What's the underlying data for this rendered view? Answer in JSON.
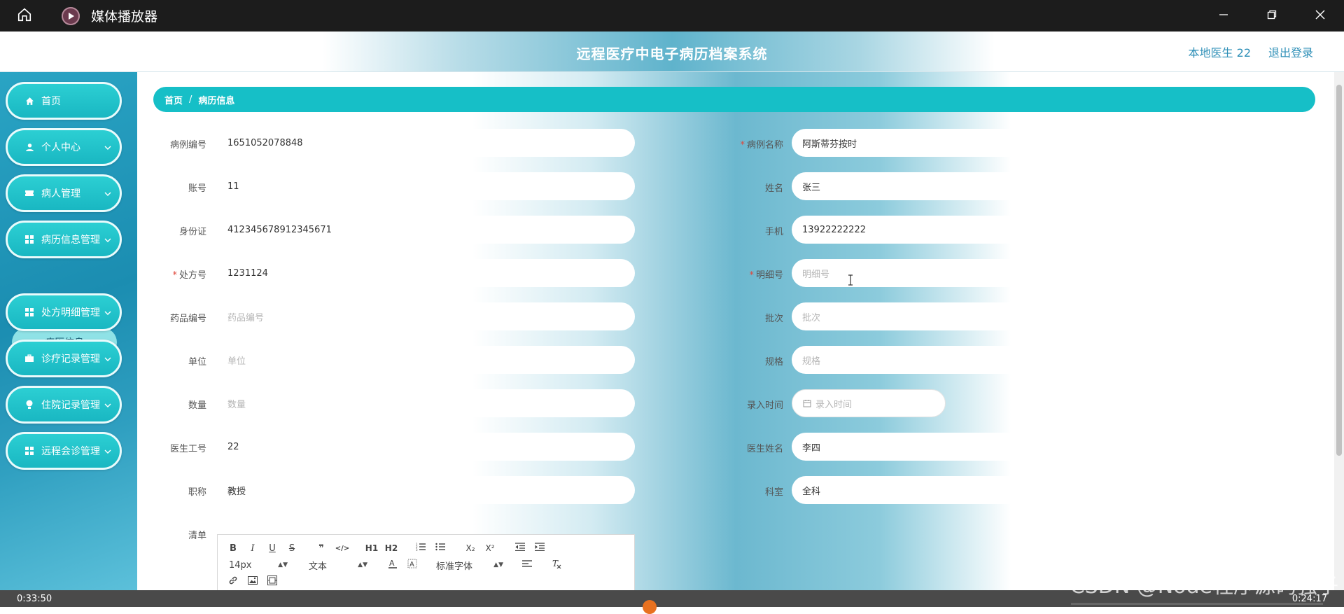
{
  "window": {
    "title": "媒体播放器"
  },
  "header": {
    "system_title": "远程医疗中电子病历档案系统",
    "user": "本地医生 22",
    "logout": "退出登录"
  },
  "sidebar": {
    "items": [
      {
        "label": "首页"
      },
      {
        "label": "个人中心"
      },
      {
        "label": "病人管理"
      },
      {
        "label": "病历信息管理"
      },
      {
        "label": "处方明细管理"
      },
      {
        "label": "诊疗记录管理"
      },
      {
        "label": "住院记录管理"
      },
      {
        "label": "远程会诊管理"
      }
    ],
    "submenu": {
      "label": "病历信息"
    }
  },
  "breadcrumb": {
    "home": "首页",
    "separator": "/",
    "current": "病历信息"
  },
  "form": {
    "left": [
      {
        "label": "病例编号",
        "value": "1651052078848",
        "required": false
      },
      {
        "label": "账号",
        "value": "11",
        "required": false
      },
      {
        "label": "身份证",
        "value": "412345678912345671",
        "required": false
      },
      {
        "label": "处方号",
        "value": "1231124",
        "required": true
      },
      {
        "label": "药品编号",
        "value": "",
        "placeholder": "药品编号",
        "required": false
      },
      {
        "label": "单位",
        "value": "",
        "placeholder": "单位",
        "required": false
      },
      {
        "label": "数量",
        "value": "",
        "placeholder": "数量",
        "required": false
      },
      {
        "label": "医生工号",
        "value": "22",
        "required": false
      },
      {
        "label": "职称",
        "value": "教授",
        "required": false
      }
    ],
    "right": [
      {
        "label": "病例名称",
        "value": "阿斯蒂芬按时",
        "required": true
      },
      {
        "label": "姓名",
        "value": "张三",
        "required": false
      },
      {
        "label": "手机",
        "value": "13922222222",
        "required": false
      },
      {
        "label": "明细号",
        "value": "",
        "placeholder": "明细号",
        "required": true
      },
      {
        "label": "批次",
        "value": "",
        "placeholder": "批次",
        "required": false
      },
      {
        "label": "规格",
        "value": "",
        "placeholder": "规格",
        "required": false
      },
      {
        "label": "录入时间",
        "value": "",
        "placeholder": "录入时间",
        "required": false
      },
      {
        "label": "医生姓名",
        "value": "李四",
        "required": false
      },
      {
        "label": "科室",
        "value": "全科",
        "required": false
      }
    ],
    "required_mark": "*",
    "list_label": "清单"
  },
  "editor": {
    "font_size": "14px",
    "text_style": "文本",
    "font_family": "标准字体",
    "buttons": [
      "B",
      "I",
      "U",
      "S",
      "❞",
      "</>",
      "H1",
      "H2",
      "ordered-list",
      "bullet-list",
      "X₂",
      "X²",
      "outdent",
      "indent",
      "text-color",
      "bg-color",
      "align",
      "clear-format",
      "link",
      "image",
      "video"
    ]
  },
  "player": {
    "elapsed": "0:33:50",
    "remaining": "0:24:17"
  },
  "watermark": "CSDN @Node程序源码强子"
}
